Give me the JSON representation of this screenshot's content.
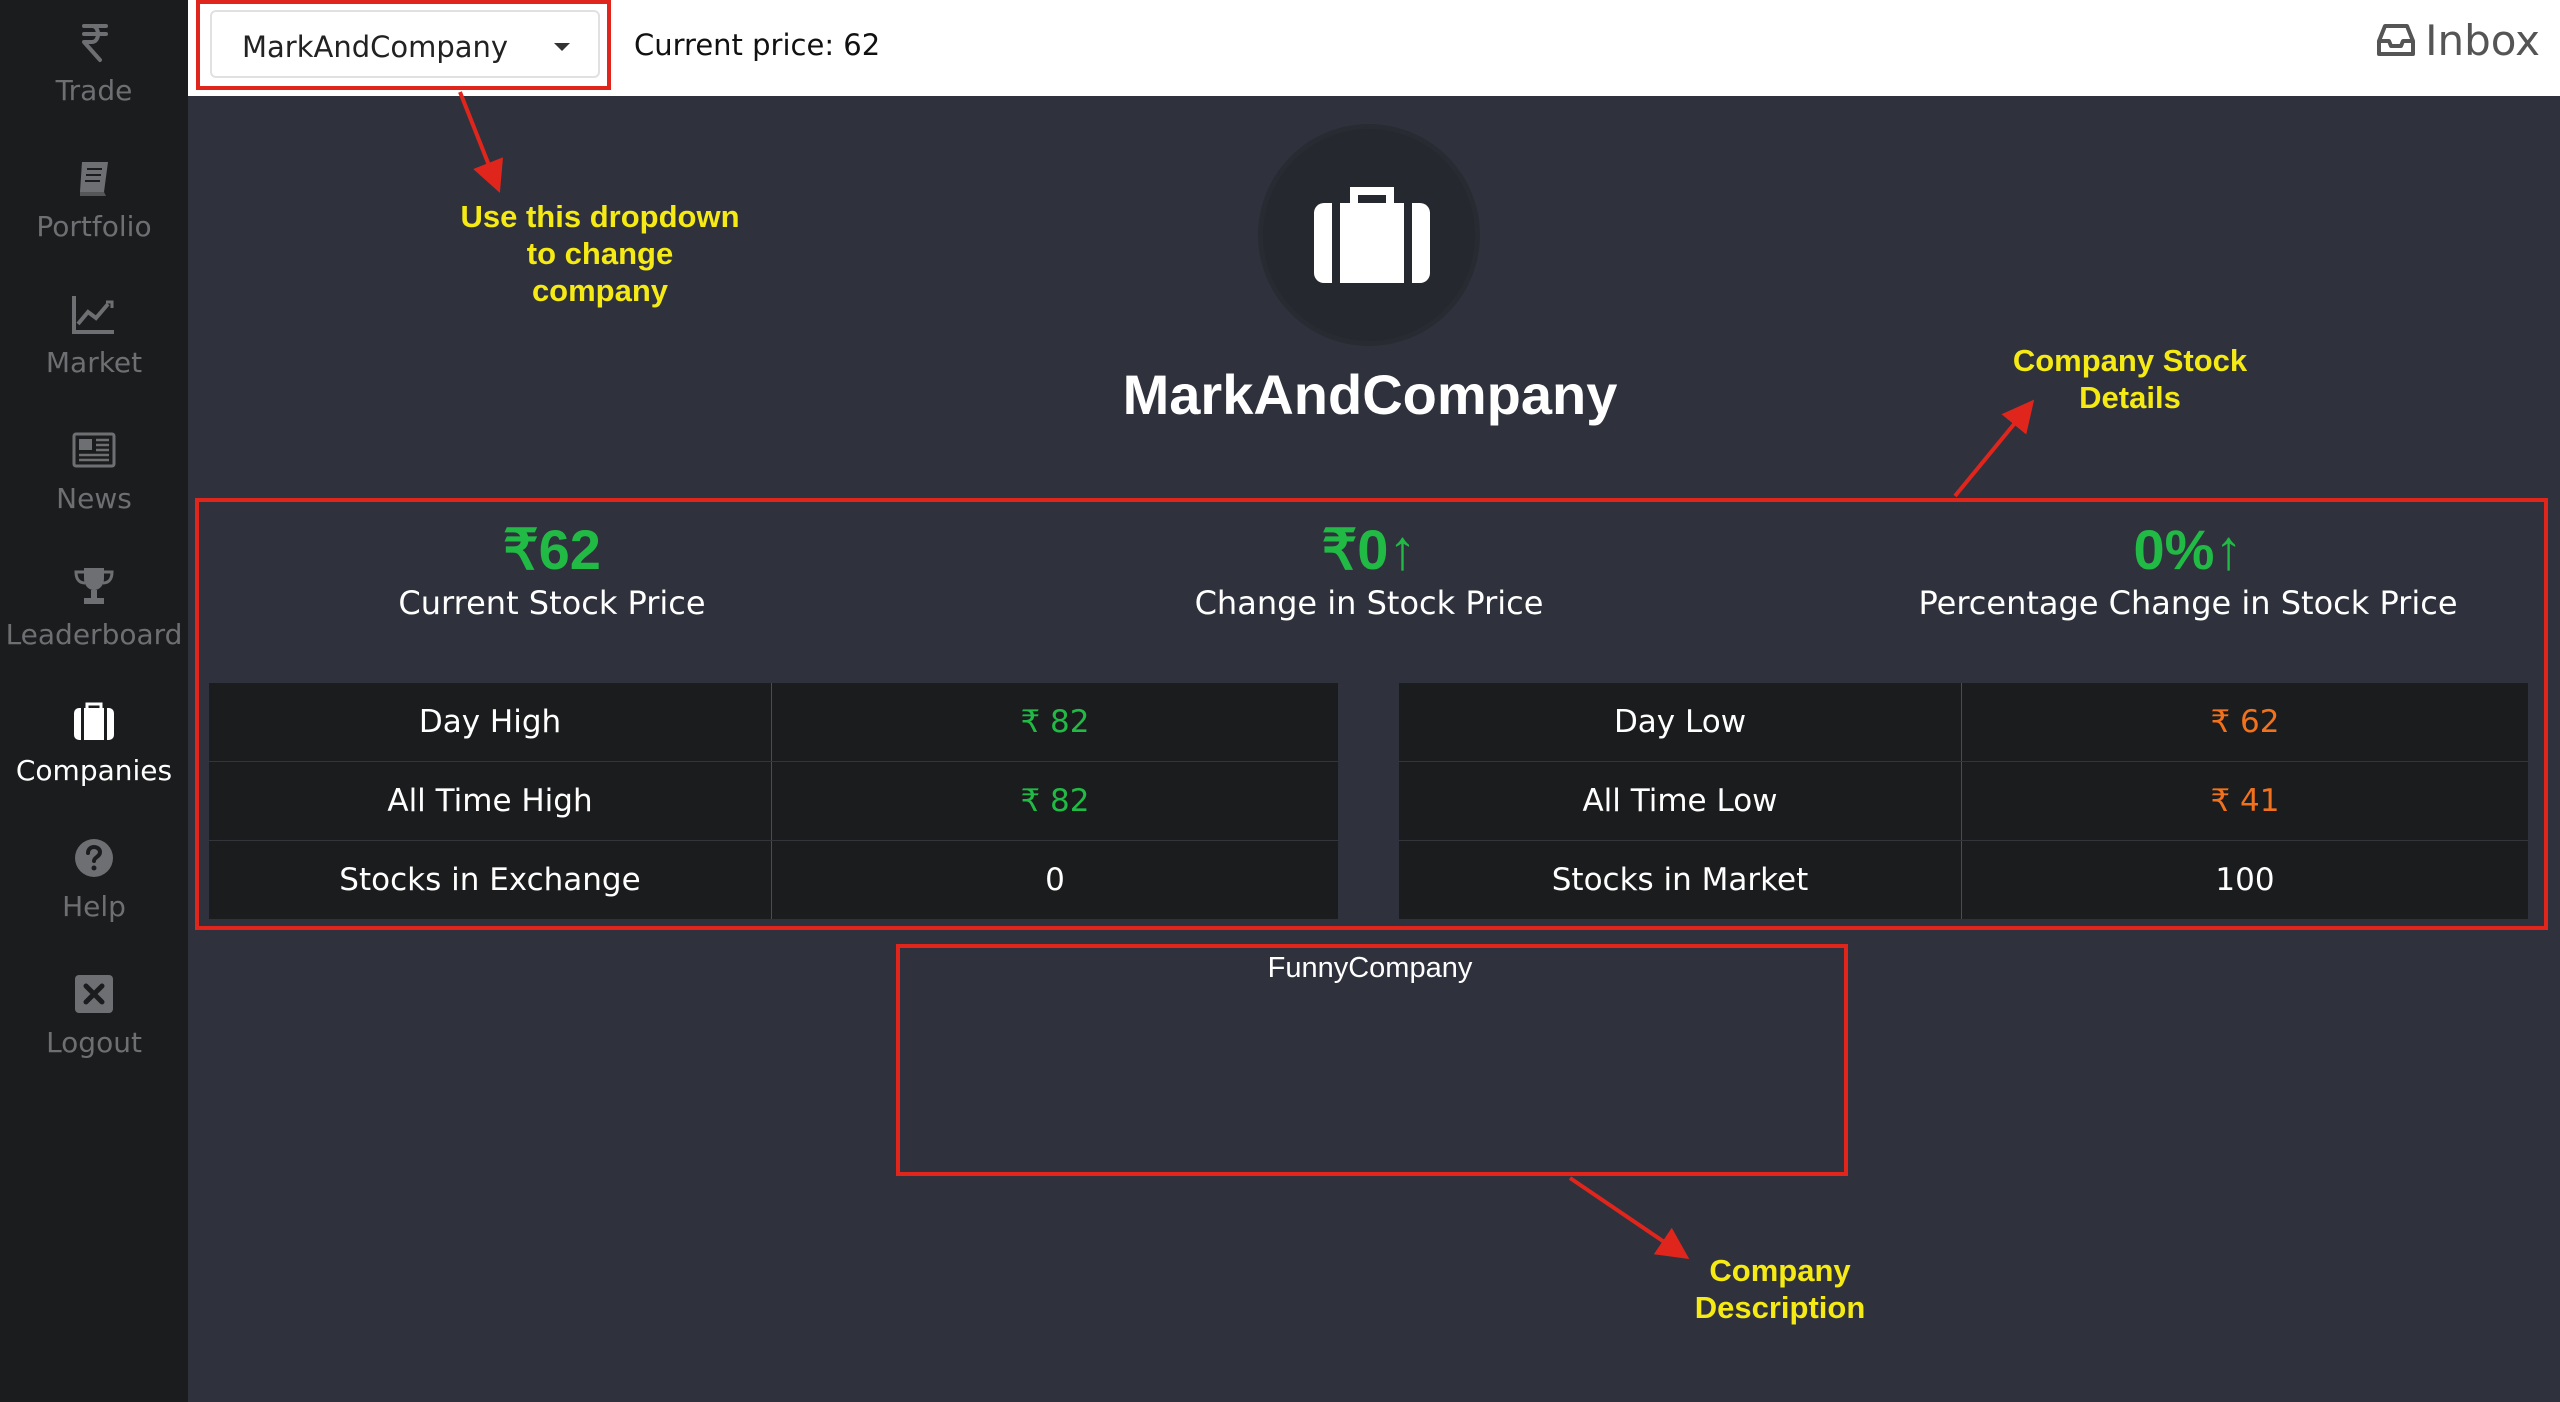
{
  "sidebar": {
    "items": [
      {
        "label": "Trade",
        "icon": "rupee-icon"
      },
      {
        "label": "Portfolio",
        "icon": "book-icon"
      },
      {
        "label": "Market",
        "icon": "line-chart-icon"
      },
      {
        "label": "News",
        "icon": "newspaper-icon"
      },
      {
        "label": "Leaderboard",
        "icon": "trophy-icon"
      },
      {
        "label": "Companies",
        "icon": "briefcase-icon",
        "active": true
      },
      {
        "label": "Help",
        "icon": "help-circle-icon"
      },
      {
        "label": "Logout",
        "icon": "close-box-icon"
      }
    ]
  },
  "topbar": {
    "company_select": {
      "selected": "MarkAndCompany"
    },
    "current_price": "Current price: 62",
    "inbox_label": "Inbox"
  },
  "company": {
    "name": "MarkAndCompany",
    "description": "FunnyCompany"
  },
  "stats": [
    {
      "value": "₹62",
      "arrow": "",
      "caption": "Current Stock Price"
    },
    {
      "value": "₹0",
      "arrow": "↑",
      "caption": "Change in Stock Price"
    },
    {
      "value": "0%",
      "arrow": "↑",
      "caption": "Percentage Change in Stock Price"
    }
  ],
  "left_table": {
    "rows": [
      {
        "label": "Day High",
        "value": "₹ 82"
      },
      {
        "label": "All Time High",
        "value": "₹ 82"
      },
      {
        "label": "Stocks in Exchange",
        "value": "0"
      }
    ]
  },
  "right_table": {
    "rows": [
      {
        "label": "Day Low",
        "value": "₹ 62"
      },
      {
        "label": "All Time Low",
        "value": "₹ 41"
      },
      {
        "label": "Stocks in Market",
        "value": "100"
      }
    ]
  },
  "annotations": {
    "dropdown_note": [
      "Use this dropdown",
      "to change",
      "company"
    ],
    "stock_details_note": [
      "Company Stock",
      "Details"
    ],
    "description_note": [
      "Company",
      "Description"
    ]
  },
  "colors": {
    "positive": "#21ba45",
    "negative": "#f2711c",
    "annotation_red": "#e0261c",
    "annotation_yellow": "#f5ea14"
  }
}
